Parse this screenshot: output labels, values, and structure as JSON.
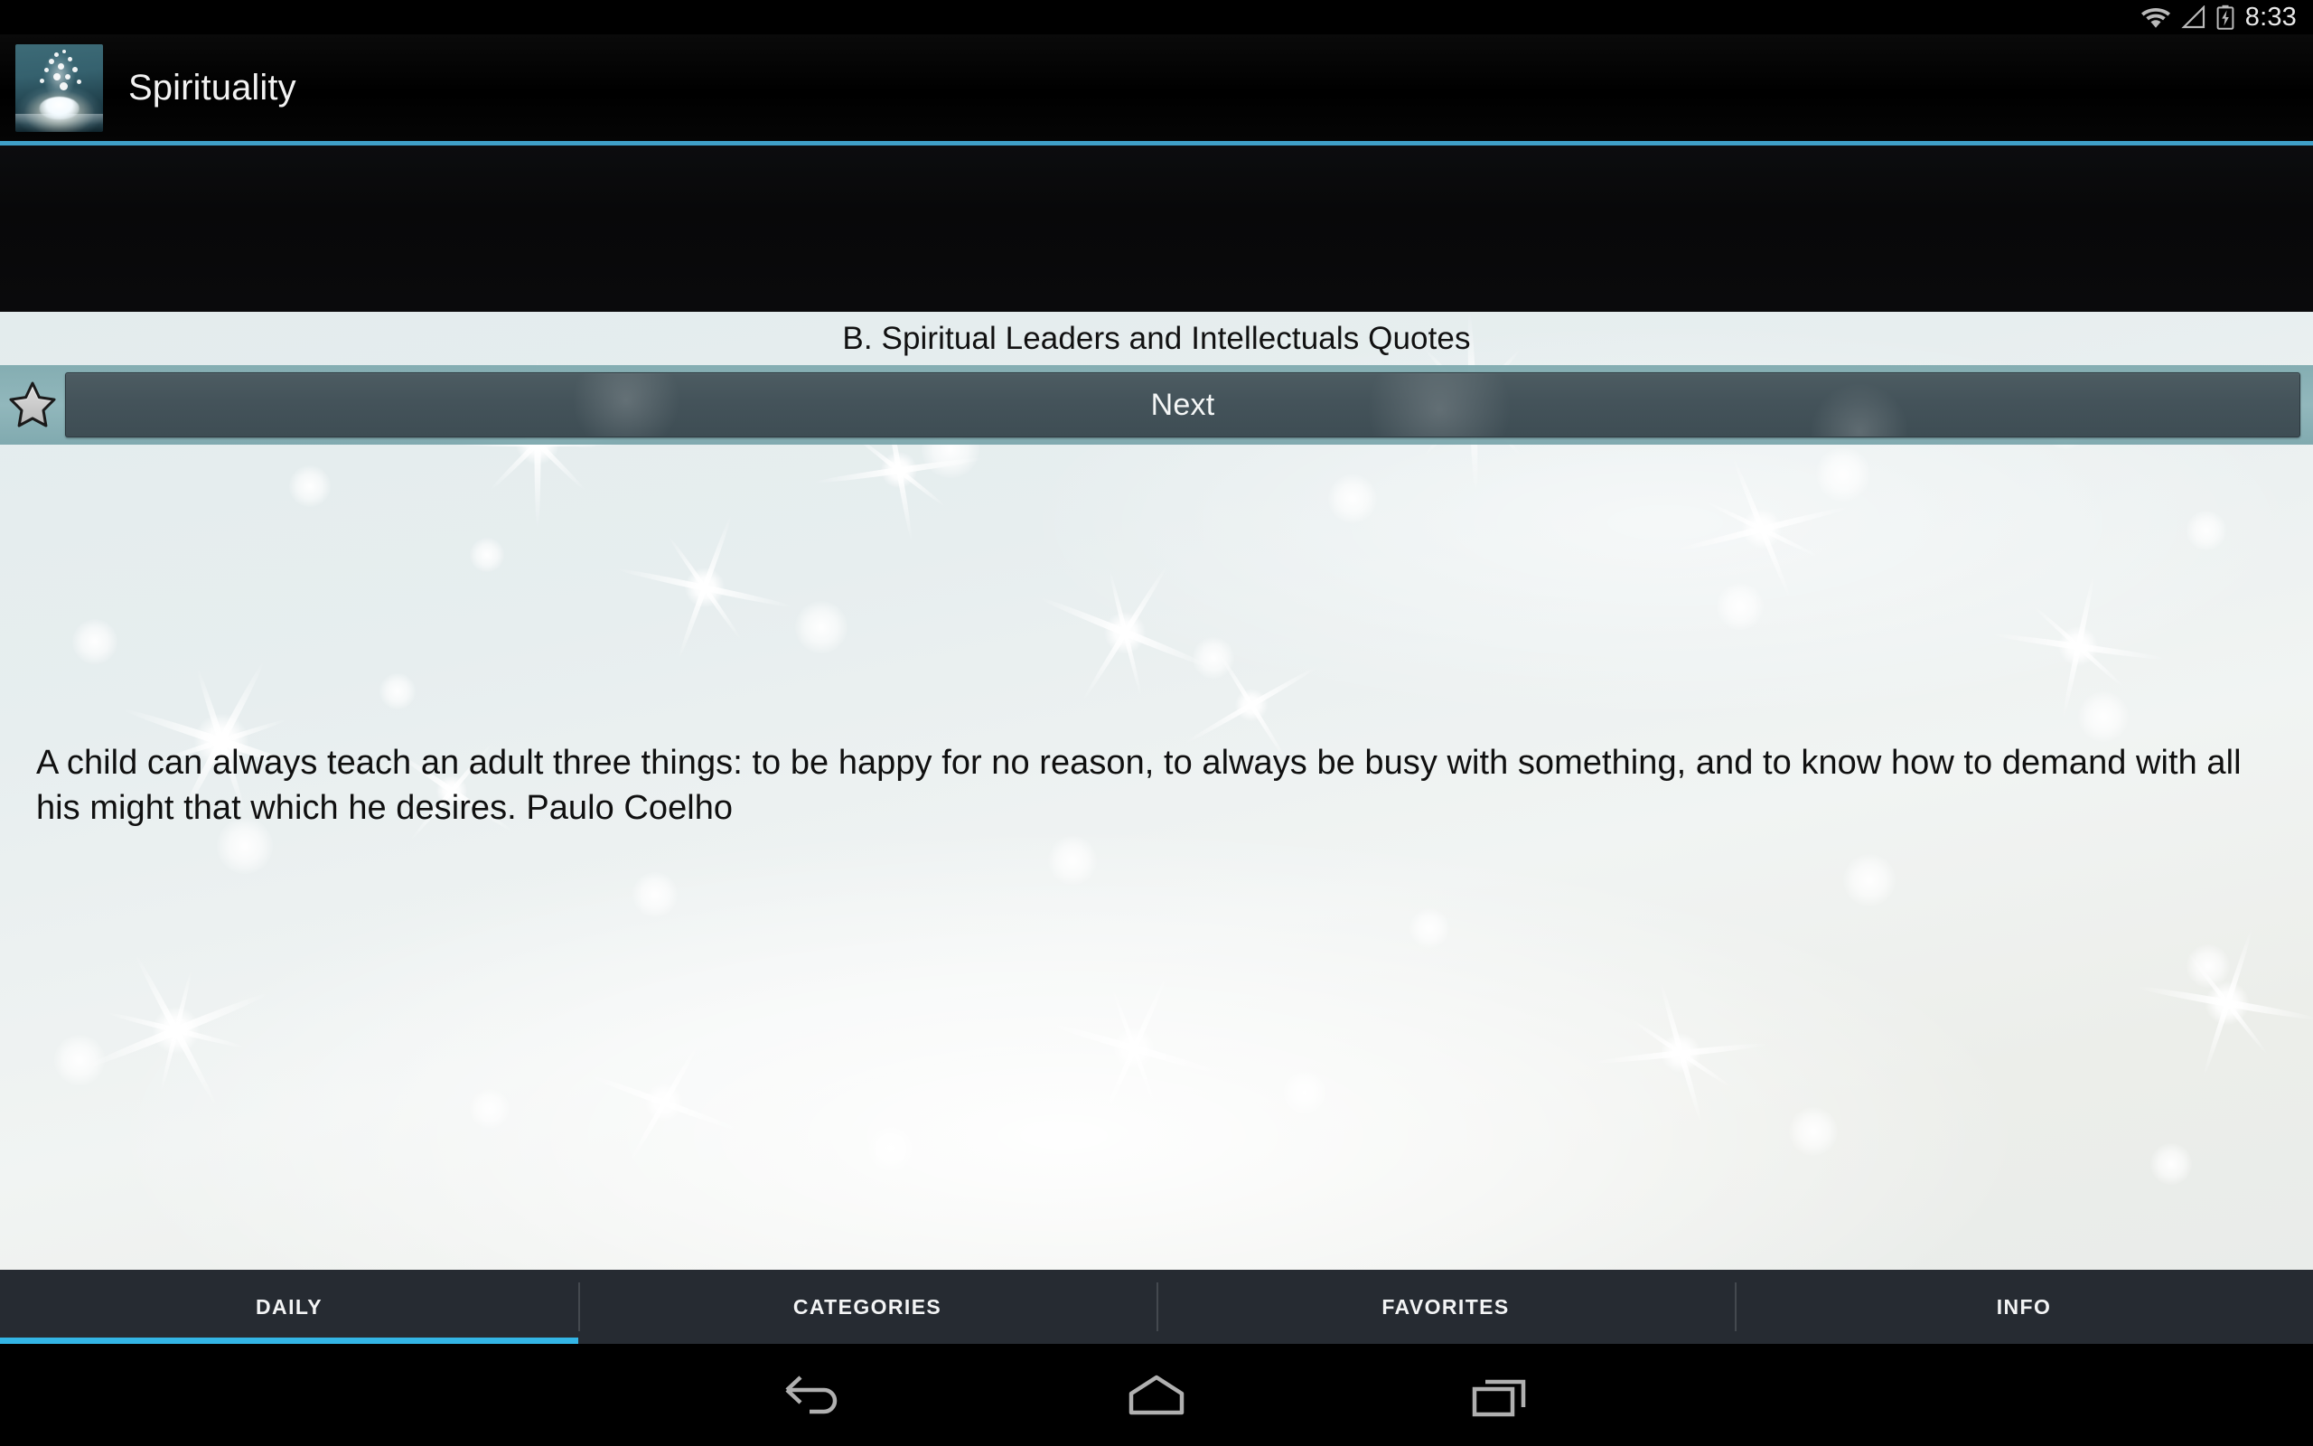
{
  "statusbar": {
    "clock": "8:33",
    "icons": [
      "wifi-icon",
      "cell-signal-icon",
      "battery-charging-icon"
    ]
  },
  "actionbar": {
    "app_title": "Spirituality",
    "logo_icon": "lotus-flower-logo",
    "accent_color": "#3fa0c8"
  },
  "quote_screen": {
    "category_title": "B. Spiritual Leaders and Intellectuals Quotes",
    "favorite_icon": "star-outline-icon",
    "next_label": "Next",
    "quote_text": "A child can always teach an adult three things: to be happy for no reason, to always be busy with something, and to know how to demand with all his might that which he desires.  Paulo Coelho",
    "author": "Paulo Coelho"
  },
  "tabs": [
    {
      "label": "DAILY",
      "active": true
    },
    {
      "label": "CATEGORIES",
      "active": false
    },
    {
      "label": "FAVORITES",
      "active": false
    },
    {
      "label": "INFO",
      "active": false
    }
  ],
  "navbar": {
    "back": "back-icon",
    "home": "home-icon",
    "recents": "recent-apps-icon"
  },
  "colors": {
    "tabbar_bg": "#262b32",
    "tab_active_indicator": "#33b5e5",
    "next_button": "#44535a",
    "teal_strip": "#7ca8ad",
    "content_bg": "#e7eeef"
  }
}
